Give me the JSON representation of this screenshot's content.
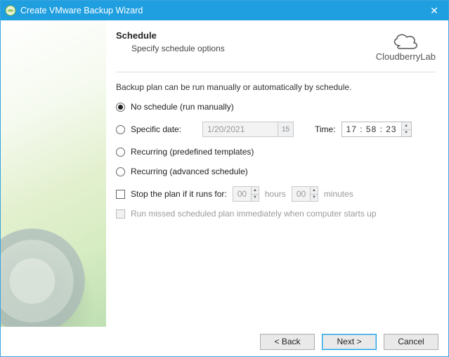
{
  "window": {
    "title": "Create VMware Backup Wizard",
    "close_glyph": "✕"
  },
  "brand": {
    "name": "CloudberryLab"
  },
  "page": {
    "heading": "Schedule",
    "subheading": "Specify schedule options",
    "description": "Backup plan can be run manually or automatically by schedule."
  },
  "options": {
    "no_schedule": "No schedule (run manually)",
    "specific_date_label": "Specific date:",
    "specific_date_value": "1/20/2021",
    "calendar_day": "15",
    "time_label": "Time:",
    "time_value": "17 : 58 : 23",
    "recurring_predefined": "Recurring (predefined templates)",
    "recurring_advanced": "Recurring (advanced schedule)"
  },
  "stop": {
    "label": "Stop the plan if it runs for:",
    "hours_value": "00",
    "hours_unit": "hours",
    "minutes_value": "00",
    "minutes_unit": "minutes"
  },
  "run_missed": {
    "label": "Run missed scheduled plan immediately when computer starts up"
  },
  "buttons": {
    "back": "< Back",
    "next": "Next >",
    "cancel": "Cancel"
  }
}
